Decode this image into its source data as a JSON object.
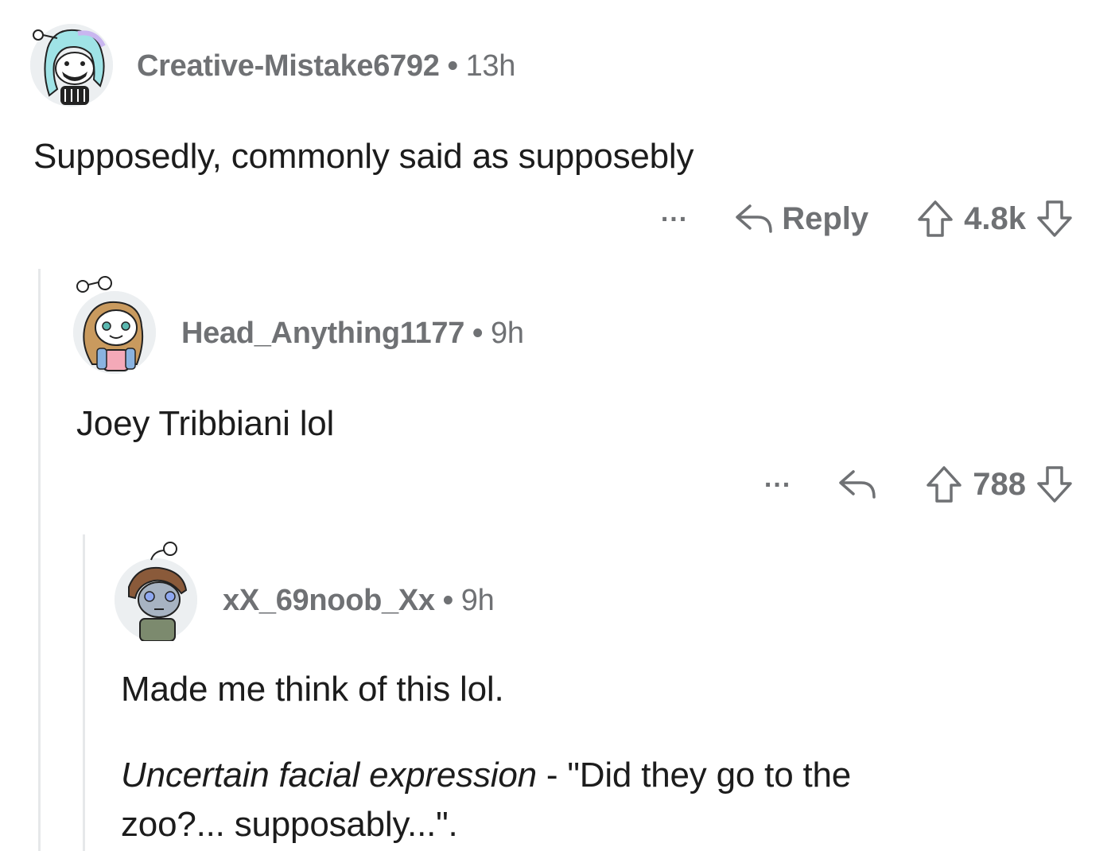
{
  "comments": [
    {
      "username": "Creative-Mistake6792",
      "time": "13h",
      "body": "Supposedly, commonly said as supposebly",
      "reply_label": "Reply",
      "score": "4.8k",
      "more_label": "..."
    },
    {
      "username": "Head_Anything1177",
      "time": "9h",
      "body": "Joey Tribbiani lol",
      "score": "788",
      "more_label": "..."
    },
    {
      "username": "xX_69noob_Xx",
      "time": "9h",
      "body_line1": "Made me think of this lol.",
      "body_italic": "Uncertain facial expression",
      "body_rest": " - \"Did they go to the",
      "body_line3": "zoo?... supposably...\"."
    }
  ],
  "separator": "•",
  "icons": {
    "reply": "reply-arrow-icon",
    "upvote": "upvote-arrow-icon",
    "downvote": "downvote-arrow-icon",
    "avatar": "snoo-avatar-icon"
  },
  "colors": {
    "meta_text": "#6f7174",
    "body_text": "#1c1c1c",
    "thread_line": "#e6e8ea"
  }
}
